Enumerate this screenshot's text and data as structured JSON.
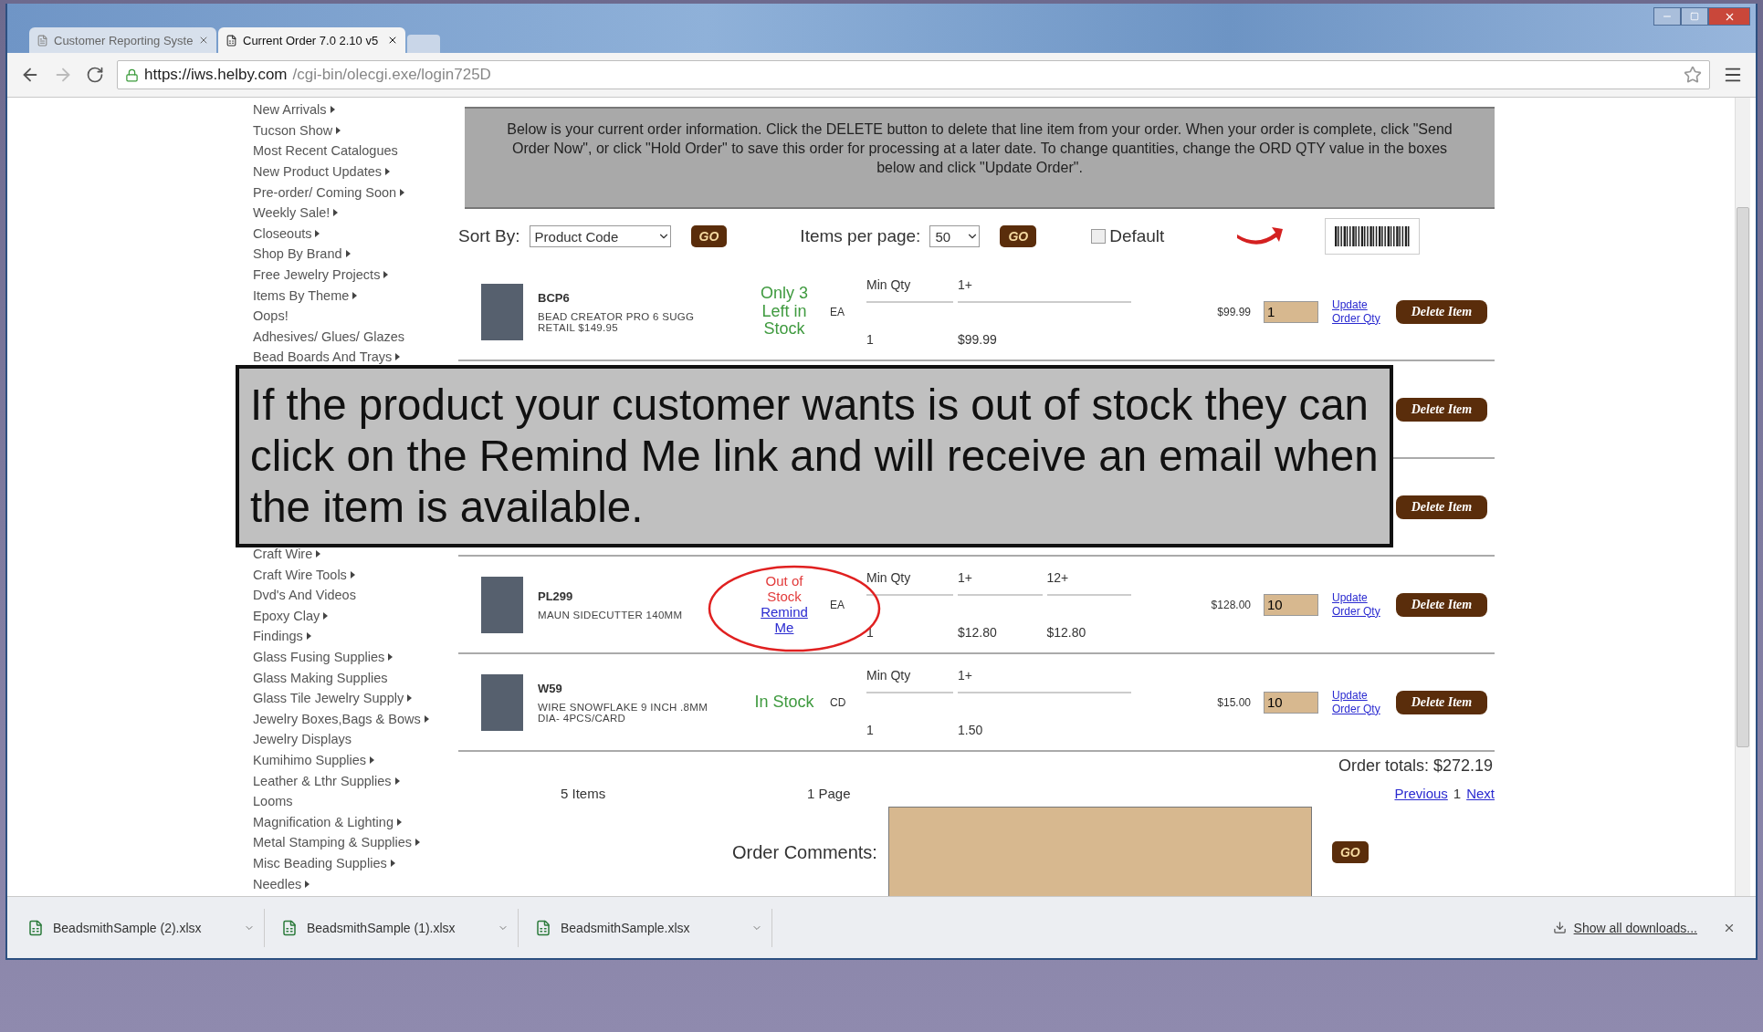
{
  "browser": {
    "tabs": [
      {
        "title": "Customer Reporting Syste",
        "selected": false
      },
      {
        "title": "Current Order 7.0 2.10 v5",
        "selected": true
      }
    ],
    "url": {
      "host": "https://iws.helby.com",
      "path": "/cgi-bin/olecgi.exe/login725D"
    }
  },
  "sidebar": {
    "items_top": [
      {
        "label": "New Arrivals",
        "submenu": true
      },
      {
        "label": "Tucson Show",
        "submenu": true
      },
      {
        "label": "Most Recent Catalogues",
        "submenu": false
      },
      {
        "label": "New Product Updates",
        "submenu": true
      },
      {
        "label": "Pre-order/ Coming Soon",
        "submenu": true
      },
      {
        "label": "Weekly Sale!",
        "submenu": true
      },
      {
        "label": "Closeouts",
        "submenu": true
      },
      {
        "label": "Shop By Brand",
        "submenu": true
      },
      {
        "label": "Free Jewelry Projects",
        "submenu": true
      },
      {
        "label": "Items By Theme",
        "submenu": true
      },
      {
        "label": "Oops!",
        "submenu": false
      },
      {
        "label": "Adhesives/ Glues/ Glazes",
        "submenu": false
      },
      {
        "label": "Bead Boards And Trays",
        "submenu": true
      }
    ],
    "items_bottom": [
      {
        "label": "Craft Wire",
        "submenu": true
      },
      {
        "label": "Craft Wire Tools",
        "submenu": true
      },
      {
        "label": "Dvd's And Videos",
        "submenu": false
      },
      {
        "label": "Epoxy Clay",
        "submenu": true
      },
      {
        "label": "Findings",
        "submenu": true
      },
      {
        "label": "Glass Fusing Supplies",
        "submenu": true
      },
      {
        "label": "Glass Making Supplies",
        "submenu": false
      },
      {
        "label": "Glass Tile Jewelry Supply",
        "submenu": true
      },
      {
        "label": "Jewelry Boxes,Bags & Bows",
        "submenu": true
      },
      {
        "label": "Jewelry Displays",
        "submenu": false
      },
      {
        "label": "Kumihimo Supplies",
        "submenu": true
      },
      {
        "label": "Leather & Lthr Supplies",
        "submenu": true
      },
      {
        "label": "Looms",
        "submenu": false
      },
      {
        "label": "Magnification & Lighting",
        "submenu": true
      },
      {
        "label": "Metal Stamping & Supplies",
        "submenu": true
      },
      {
        "label": "Misc Beading Supplies",
        "submenu": true
      },
      {
        "label": "Needles",
        "submenu": true
      }
    ]
  },
  "banner": "Below is your current order information. Click the DELETE button to delete that line item from your order. When your order is complete, click \"Send Order Now\", or click \"Hold Order\" to save this order for processing at a later date. To change quantities, change the ORD QTY value in the boxes below and click \"Update Order\".",
  "controls": {
    "sort": {
      "label": "Sort By:",
      "value": "Product Code",
      "go": "GO"
    },
    "per_page": {
      "label": "Items per page:",
      "value": "50",
      "go": "GO"
    },
    "default": {
      "label": "Default",
      "checked": false
    }
  },
  "items": [
    {
      "kind": "product",
      "code": "BCP6",
      "description": "BEAD CREATOR PRO 6 SUGG RETAIL $149.95",
      "status": {
        "kind": "low_stock",
        "text": "Only 3 Left in Stock"
      },
      "unit": "EA",
      "tiers": [
        {
          "header": "Min Qty",
          "value": "1"
        },
        {
          "header": "1+",
          "value": "$99.99"
        }
      ],
      "price": "$99.99",
      "qty": "1",
      "update": "Update Order Qty",
      "delete": "Delete Item"
    },
    {
      "kind": "covered",
      "delete": "Delete Item"
    },
    {
      "kind": "covered",
      "delete": "Delete Item"
    },
    {
      "kind": "product",
      "code": "PL299",
      "description": "MAUN SIDECUTTER 140MM",
      "status": {
        "kind": "out_of_stock",
        "text": "Out of Stock",
        "link": "Remind Me"
      },
      "unit": "EA",
      "tiers": [
        {
          "header": "Min Qty",
          "value": "1"
        },
        {
          "header": "1+",
          "value": "$12.80"
        },
        {
          "header": "12+",
          "value": "$12.80"
        }
      ],
      "price": "$128.00",
      "qty": "10",
      "update": "Update Order Qty",
      "delete": "Delete Item",
      "circled": true
    },
    {
      "kind": "product",
      "code": "W59",
      "description": "WIRE SNOWFLAKE 9 INCH .8MM DIA- 4PCS/CARD",
      "status": {
        "kind": "in_stock",
        "text": "In Stock"
      },
      "unit": "CD",
      "tiers": [
        {
          "header": "Min Qty",
          "value": "1"
        },
        {
          "header": "1+",
          "value": "1.50"
        }
      ],
      "price": "$15.00",
      "qty": "10",
      "update": "Update Order Qty",
      "delete": "Delete Item"
    }
  ],
  "totals": "Order totals: $272.19",
  "footer": {
    "items": "5 Items",
    "pages": "1 Page",
    "previous": "Previous",
    "page": "1",
    "next": "Next"
  },
  "comments": {
    "label": "Order Comments:",
    "go": "GO"
  },
  "callout": "If the product your customer wants is out of stock they can click on the Remind Me link and will receive an email when the item is available.",
  "downloads": {
    "files": [
      "BeadsmithSample (2).xlsx",
      "BeadsmithSample (1).xlsx",
      "BeadsmithSample.xlsx"
    ],
    "show_all": "Show all downloads..."
  }
}
